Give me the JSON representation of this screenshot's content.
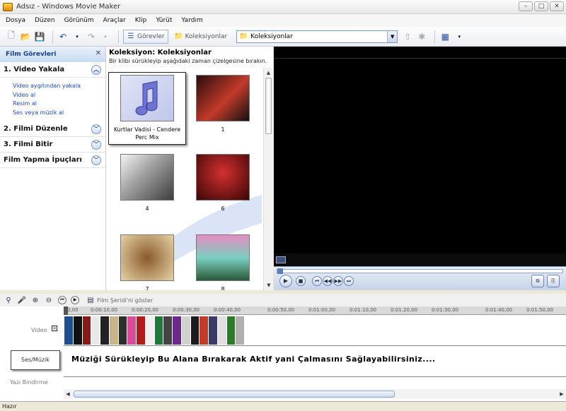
{
  "window": {
    "title": "Adsız - Windows Movie Maker"
  },
  "menu": [
    "Dosya",
    "Düzen",
    "Görünüm",
    "Araçlar",
    "Klip",
    "Yürüt",
    "Yardım"
  ],
  "toolbar": {
    "tasks_label": "Görevler",
    "collections_label": "Koleksiyonlar",
    "collection_select_value": "Koleksiyonlar"
  },
  "tasks_panel": {
    "header": "Film Görevleri",
    "sections": [
      {
        "title": "1. Video Yakala",
        "expanded": true,
        "links": [
          "Video aygıtından yakala",
          "Video al",
          "Resim al",
          "Ses veya müzik al"
        ]
      },
      {
        "title": "2. Filmi Düzenle",
        "expanded": false,
        "links": []
      },
      {
        "title": "3. Filmi Bitir",
        "expanded": false,
        "links": []
      },
      {
        "title": "Film Yapma İpuçları",
        "expanded": false,
        "links": []
      }
    ]
  },
  "collection": {
    "title": "Koleksiyon: Koleksiyonlar",
    "subtitle": "Bir klibi sürükleyip aşağıdaki zaman çizelgesine bırakın.",
    "items": [
      {
        "caption": "Kurtlar Vadisi - Cendere Perc Mix",
        "thumb_colors": [
          "#7b85d4",
          "#e0e4f6"
        ],
        "selected": true,
        "kind": "audio"
      },
      {
        "caption": "1",
        "thumb_colors": [
          "#2a0d0d",
          "#c23a2a"
        ],
        "selected": false,
        "kind": "image"
      },
      {
        "caption": "4",
        "thumb_colors": [
          "#bdbdbd",
          "#3d3d3d"
        ],
        "selected": false,
        "kind": "image"
      },
      {
        "caption": "6",
        "thumb_colors": [
          "#b81818",
          "#3b0606"
        ],
        "selected": false,
        "kind": "image"
      },
      {
        "caption": "7",
        "thumb_colors": [
          "#d9c49a",
          "#5b3b1a"
        ],
        "selected": false,
        "kind": "image"
      },
      {
        "caption": "8",
        "thumb_colors": [
          "#e089b9",
          "#2a6a44"
        ],
        "selected": false,
        "kind": "image"
      }
    ]
  },
  "timeline": {
    "storyboard_label": "Film Şeridi'ni göster",
    "ruler_ticks": [
      "0,00",
      "0:00:10,00",
      "0:00:20,00",
      "0:00:30,00",
      "0:00:40,00",
      "0:00:50,00",
      "0:01:00,00",
      "0:01:10,00",
      "0:01:20,00",
      "0:01:30,00",
      "0:01:40,00",
      "0:01:50,00"
    ],
    "tracks": {
      "video": "Video",
      "audio": "Ses/Müzik",
      "title": "Yazı Bindirme"
    },
    "audio_message": "Müziği Sürükleyip Bu Alana Bırakarak Aktif yani Çalmasını Sağlayabilirsiniz....",
    "clip_colors": [
      "#1d4f8f",
      "#111111",
      "#8a1a1a",
      "#e8e8e8",
      "#222222",
      "#c8b48a",
      "#2e2e2e",
      "#d84c9a",
      "#b01c1c",
      "#f0f0f0",
      "#1e7a3a",
      "#444444",
      "#6a2a8a",
      "#d0d0d0",
      "#1c1c1c",
      "#c23a2a",
      "#3a3a6a",
      "#e0e0e0",
      "#2a7a2a",
      "#b0b0b0"
    ]
  },
  "status": {
    "text": "Hazır"
  },
  "colors": {
    "link": "#1a48c4",
    "panel_header": "#15428b",
    "preview_bg": "#000000"
  }
}
